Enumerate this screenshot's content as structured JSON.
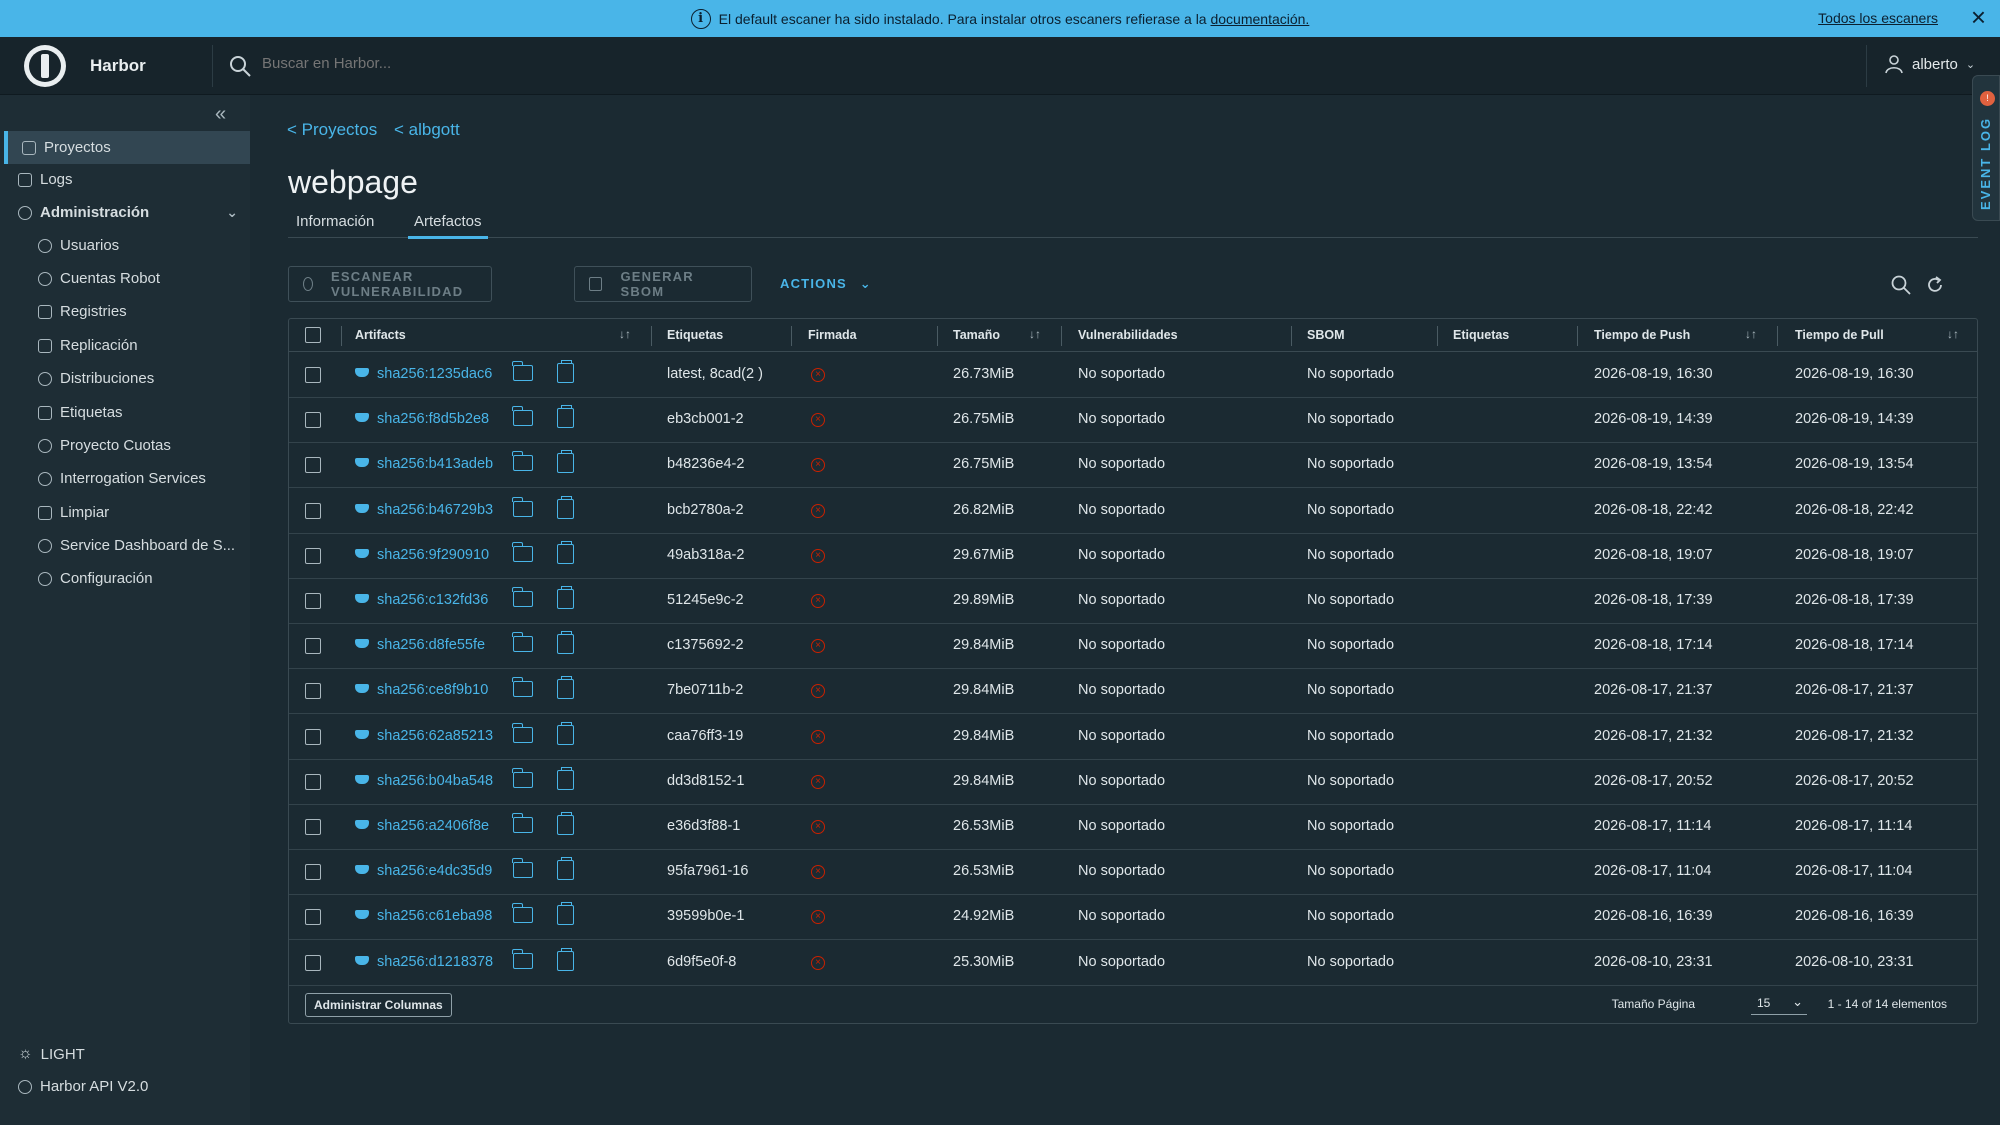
{
  "banner": {
    "text": "El default escaner ha sido instalado. Para instalar otros escaners refierase a la",
    "link": "documentación.",
    "right_link": "Todos los escaners"
  },
  "header": {
    "brand": "Harbor",
    "search_placeholder": "Buscar en Harbor...",
    "user": "alberto"
  },
  "sidebar": {
    "items": [
      {
        "label": "Proyectos",
        "icon": "projects-icon"
      },
      {
        "label": "Logs",
        "icon": "logs-icon"
      },
      {
        "label": "Administración",
        "icon": "admin-icon"
      },
      {
        "label": "Usuarios",
        "icon": "users-icon"
      },
      {
        "label": "Cuentas Robot",
        "icon": "robot-icon"
      },
      {
        "label": "Registries",
        "icon": "registries-icon"
      },
      {
        "label": "Replicación",
        "icon": "replication-icon"
      },
      {
        "label": "Distribuciones",
        "icon": "distribution-icon"
      },
      {
        "label": "Etiquetas",
        "icon": "tag-icon"
      },
      {
        "label": "Proyecto Cuotas",
        "icon": "quota-icon"
      },
      {
        "label": "Interrogation Services",
        "icon": "shield-icon"
      },
      {
        "label": "Limpiar",
        "icon": "trash-icon"
      },
      {
        "label": "Service Dashboard de S...",
        "icon": "dashboard-icon"
      },
      {
        "label": "Configuración",
        "icon": "gear-icon"
      }
    ],
    "theme": "LIGHT",
    "api": "Harbor API V2.0"
  },
  "breadcrumb": [
    "< Proyectos",
    "< albgott"
  ],
  "page_title": "webpage",
  "tabs": [
    "Información",
    "Artefactos"
  ],
  "toolbar": {
    "scan": "ESCANEAR VULNERABILIDAD",
    "sbom": "GENERAR SBOM",
    "actions": "ACTIONS"
  },
  "table": {
    "headers": [
      "Artifacts",
      "Etiquetas",
      "Firmada",
      "Tamaño",
      "Vulnerabilidades",
      "SBOM",
      "Etiquetas",
      "Tiempo de Push",
      "Tiempo de Pull"
    ],
    "rows": [
      {
        "digest": "sha256:1235dac6",
        "tags": "latest, 8cad(2 )",
        "size": "26.73MiB",
        "vuln": "No soportado",
        "sbom": "No soportado",
        "push": "2026-08-19, 16:30",
        "pull": "2026-08-19, 16:30"
      },
      {
        "digest": "sha256:f8d5b2e8",
        "tags": "eb3cb001-2",
        "size": "26.75MiB",
        "vuln": "No soportado",
        "sbom": "No soportado",
        "push": "2026-08-19, 14:39",
        "pull": "2026-08-19, 14:39"
      },
      {
        "digest": "sha256:b413adeb",
        "tags": "b48236e4-2",
        "size": "26.75MiB",
        "vuln": "No soportado",
        "sbom": "No soportado",
        "push": "2026-08-19, 13:54",
        "pull": "2026-08-19, 13:54"
      },
      {
        "digest": "sha256:b46729b3",
        "tags": "bcb2780a-2",
        "size": "26.82MiB",
        "vuln": "No soportado",
        "sbom": "No soportado",
        "push": "2026-08-18, 22:42",
        "pull": "2026-08-18, 22:42"
      },
      {
        "digest": "sha256:9f290910",
        "tags": "49ab318a-2",
        "size": "29.67MiB",
        "vuln": "No soportado",
        "sbom": "No soportado",
        "push": "2026-08-18, 19:07",
        "pull": "2026-08-18, 19:07"
      },
      {
        "digest": "sha256:c132fd36",
        "tags": "51245e9c-2",
        "size": "29.89MiB",
        "vuln": "No soportado",
        "sbom": "No soportado",
        "push": "2026-08-18, 17:39",
        "pull": "2026-08-18, 17:39"
      },
      {
        "digest": "sha256:d8fe55fe",
        "tags": "c1375692-2",
        "size": "29.84MiB",
        "vuln": "No soportado",
        "sbom": "No soportado",
        "push": "2026-08-18, 17:14",
        "pull": "2026-08-18, 17:14"
      },
      {
        "digest": "sha256:ce8f9b10",
        "tags": "7be0711b-2",
        "size": "29.84MiB",
        "vuln": "No soportado",
        "sbom": "No soportado",
        "push": "2026-08-17, 21:37",
        "pull": "2026-08-17, 21:37"
      },
      {
        "digest": "sha256:62a85213",
        "tags": "caa76ff3-19",
        "size": "29.84MiB",
        "vuln": "No soportado",
        "sbom": "No soportado",
        "push": "2026-08-17, 21:32",
        "pull": "2026-08-17, 21:32"
      },
      {
        "digest": "sha256:b04ba548",
        "tags": "dd3d8152-1",
        "size": "29.84MiB",
        "vuln": "No soportado",
        "sbom": "No soportado",
        "push": "2026-08-17, 20:52",
        "pull": "2026-08-17, 20:52"
      },
      {
        "digest": "sha256:a2406f8e",
        "tags": "e36d3f88-1",
        "size": "26.53MiB",
        "vuln": "No soportado",
        "sbom": "No soportado",
        "push": "2026-08-17, 11:14",
        "pull": "2026-08-17, 11:14"
      },
      {
        "digest": "sha256:e4dc35d9",
        "tags": "95fa7961-16",
        "size": "26.53MiB",
        "vuln": "No soportado",
        "sbom": "No soportado",
        "push": "2026-08-17, 11:04",
        "pull": "2026-08-17, 11:04"
      },
      {
        "digest": "sha256:c61eba98",
        "tags": "39599b0e-1",
        "size": "24.92MiB",
        "vuln": "No soportado",
        "sbom": "No soportado",
        "push": "2026-08-16, 16:39",
        "pull": "2026-08-16, 16:39"
      },
      {
        "digest": "sha256:d1218378",
        "tags": "6d9f5e0f-8",
        "size": "25.30MiB",
        "vuln": "No soportado",
        "sbom": "No soportado",
        "push": "2026-08-10, 23:31",
        "pull": "2026-08-10, 23:31"
      }
    ]
  },
  "footer": {
    "manage_columns": "Administrar Columnas",
    "page_size_label": "Tamaño Página",
    "page_size": "15",
    "count": "1 - 14 of 14 elementos"
  },
  "event_log": "EVENT LOG",
  "colors": {
    "accent": "#49b5e8",
    "banner": "#49b5e8",
    "danger": "#c92100"
  }
}
